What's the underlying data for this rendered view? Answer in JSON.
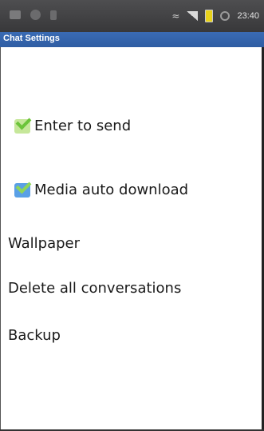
{
  "status_bar": {
    "time": "23:40",
    "icons": [
      "notification-icon",
      "android-icon",
      "usb-icon",
      "wifi-icon",
      "signal-icon",
      "battery-icon",
      "alarm-icon"
    ]
  },
  "title_bar": {
    "title": "Chat Settings",
    "color": "#3a6bb4"
  },
  "preferences": {
    "enter_to_send": {
      "label": "Enter to send",
      "checked": true
    },
    "media_auto_download": {
      "label": "Media auto download",
      "checked": true
    },
    "wallpaper": {
      "label": "Wallpaper"
    },
    "delete_all": {
      "label": "Delete all conversations"
    },
    "backup": {
      "label": "Backup"
    }
  }
}
